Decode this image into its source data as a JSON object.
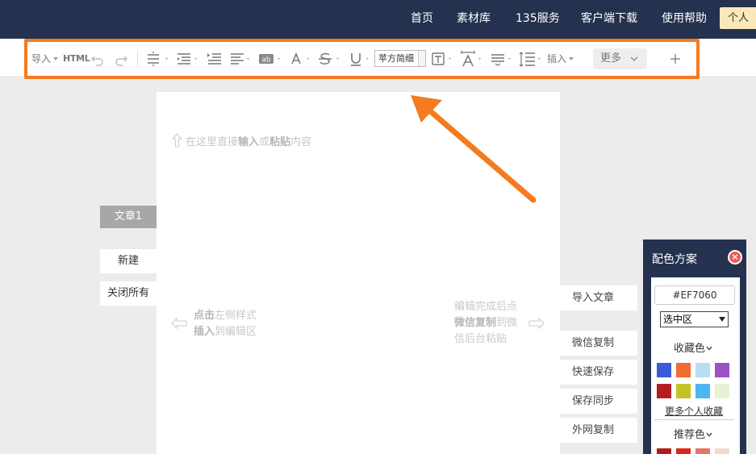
{
  "nav": {
    "items": [
      "首页",
      "素材库",
      "135服务",
      "客户端下载",
      "使用帮助"
    ],
    "personal": "个人"
  },
  "toolbar": {
    "import_label": "导入",
    "html_label": "HTML",
    "font_value": "苹方简细",
    "insert_label": "插入",
    "more_label": "更多",
    "highlight_color": "#f47b20"
  },
  "editor": {
    "top_hint_pre": "在这里直接",
    "top_hint_b1": "输入",
    "top_hint_mid": "或",
    "top_hint_b2": "粘贴",
    "top_hint_post": "内容",
    "left_hint_b1": "点击",
    "left_hint_t1": "左侧样式",
    "left_hint_b2": "插入",
    "left_hint_t2": "到编辑区",
    "right_hint_l1": "编辑完成后点",
    "right_hint_b": "微信复制",
    "right_hint_t2": "到微",
    "right_hint_l3": "信后台粘贴"
  },
  "left_panel": {
    "article_tab": "文章1",
    "new_button": "新建",
    "close_all_button": "关闭所有"
  },
  "right_actions": [
    "导入文章",
    "微信复制",
    "快速保存",
    "保存同步",
    "外网复制"
  ],
  "color_panel": {
    "title": "配色方案",
    "hex_value": "#EF7060",
    "scope_value": "选中区",
    "favorites_label": "收藏色",
    "more_favorites_link": "更多个人收藏",
    "recommended_label": "推荐色",
    "favorite_colors": [
      "#3b5bd6",
      "#f26b33",
      "#b9def2",
      "#9b52c7",
      "#b51e1e",
      "#c3c424",
      "#4ab6f2",
      "#e7f2d4"
    ],
    "recommended_colors": [
      "#b31b1b",
      "#d7281e",
      "#e8746a",
      "#f5d8d0"
    ]
  }
}
